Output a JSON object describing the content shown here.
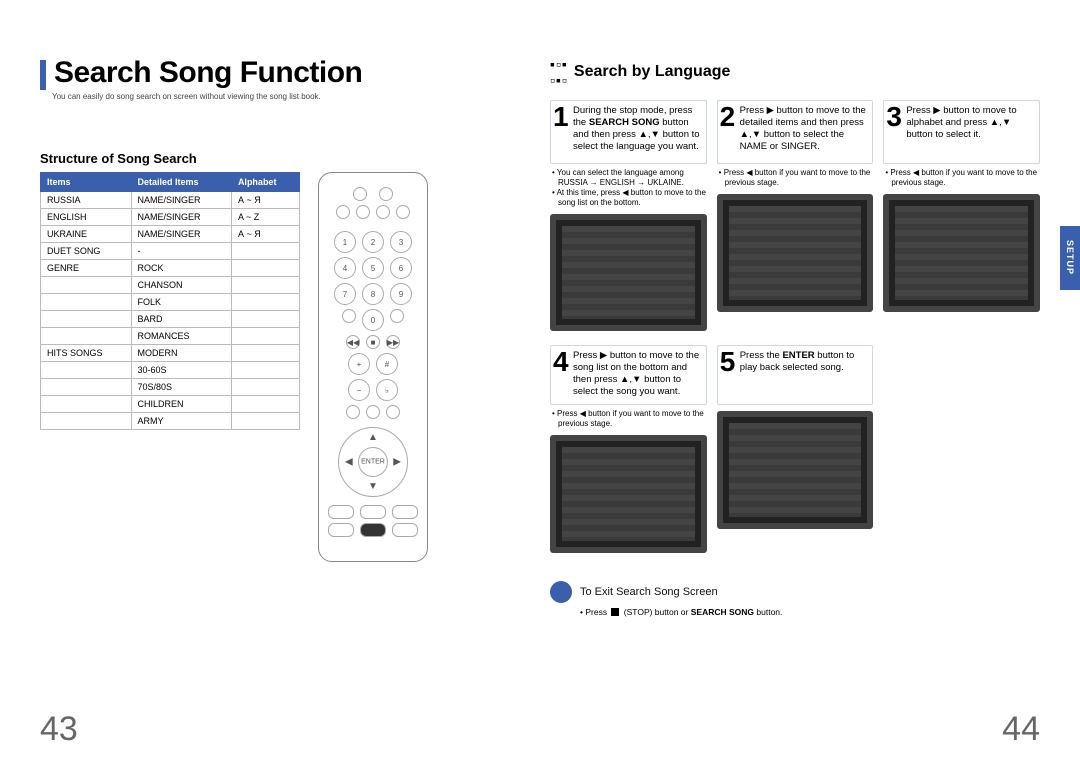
{
  "page_left": {
    "title": "Search Song Function",
    "subtitle": "You can easily do song search on screen without viewing the song list book.",
    "structure_heading": "Structure of Song Search",
    "table": {
      "headers": [
        "Items",
        "Detailed Items",
        "Alphabet"
      ],
      "rows": [
        [
          "RUSSIA",
          "NAME/SINGER",
          "А ~ Я"
        ],
        [
          "ENGLISH",
          "NAME/SINGER",
          "A ~ Z"
        ],
        [
          "UKRAINE",
          "NAME/SINGER",
          "А ~ Я"
        ],
        [
          "DUET SONG",
          "-",
          ""
        ],
        [
          "GENRE",
          "ROCK",
          ""
        ],
        [
          "",
          "CHANSON",
          ""
        ],
        [
          "",
          "FOLK",
          ""
        ],
        [
          "",
          "BARD",
          ""
        ],
        [
          "",
          "ROMANCES",
          ""
        ],
        [
          "HITS SONGS",
          "MODERN",
          ""
        ],
        [
          "",
          "30-60S",
          ""
        ],
        [
          "",
          "70S/80S",
          ""
        ],
        [
          "",
          "CHILDREN",
          ""
        ],
        [
          "",
          "ARMY",
          ""
        ]
      ]
    },
    "remote_enter_label": "ENTER",
    "page_number": "43"
  },
  "page_right": {
    "section_title": "Search by Language",
    "steps_top": [
      {
        "num": "1",
        "text_before": "During the stop mode, press the ",
        "bold1": "SEARCH SONG",
        "text_mid": " button and then press ▲,▼ button to select the language you want.",
        "notes": [
          "You can select the language among RUSSIA → ENGLISH → UKLAINE.",
          "At this time, press ◀ button to move to the song list on the bottom."
        ]
      },
      {
        "num": "2",
        "text": "Press ▶ button to move to the detailed items and then press ▲,▼ button to select the NAME or SINGER.",
        "notes": [
          "Press ◀ button if you want to move to the previous stage."
        ]
      },
      {
        "num": "3",
        "text": "Press ▶ button to move to alphabet and press ▲,▼ button to select it.",
        "notes": [
          "Press ◀ button if you want to move to the previous stage."
        ]
      }
    ],
    "steps_bottom": [
      {
        "num": "4",
        "text": "Press ▶ button to move to the song list on the bottom and then press ▲,▼ button to select the song you want.",
        "notes": [
          "Press ◀ button if you want to move to the previous stage."
        ]
      },
      {
        "num": "5",
        "text_before": "Press the ",
        "bold1": "ENTER",
        "text_after": " button to play back selected song."
      }
    ],
    "exit_label": "To Exit Search Song Screen",
    "exit_note_before": "Press ",
    "exit_note_mid": " (STOP) button or ",
    "exit_note_bold": "SEARCH SONG",
    "exit_note_after": " button.",
    "side_tab": "SETUP",
    "page_number": "44"
  }
}
